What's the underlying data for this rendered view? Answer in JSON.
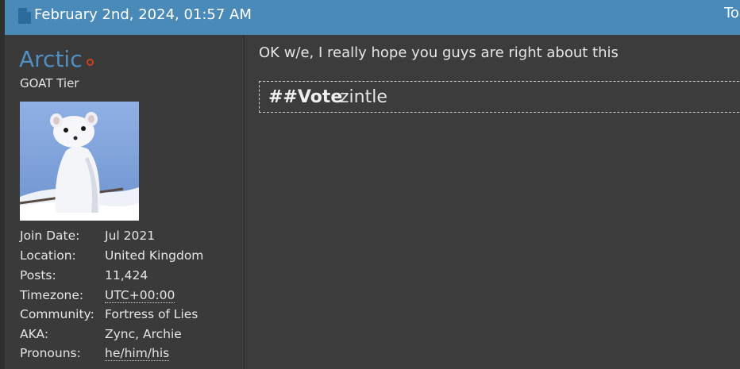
{
  "post": {
    "date": "February 2nd, 2024, 01:57 AM",
    "top_link": "To"
  },
  "user": {
    "name": "Arctic",
    "rank": "GOAT Tier",
    "avatar": "white stoat in snow",
    "info": [
      {
        "key": "Join Date:",
        "value": "Jul 2021"
      },
      {
        "key": "Location:",
        "value": "United Kingdom"
      },
      {
        "key": "Posts:",
        "value": "11,424"
      },
      {
        "key": "Timezone:",
        "value": "UTC+00:00"
      },
      {
        "key": "Community:",
        "value": "Fortress of Lies"
      },
      {
        "key": "AKA:",
        "value": "Zync, Archie"
      },
      {
        "key": "Pronouns:",
        "value": "he/him/his"
      }
    ]
  },
  "message": {
    "text": "OK w/e, I really hope you guys are right about this",
    "vote_label": "##Vote",
    "vote_target": "zintle"
  },
  "colors": {
    "header": "#4a8ab8",
    "username": "#4f8fc4",
    "online": "#d0401e"
  }
}
